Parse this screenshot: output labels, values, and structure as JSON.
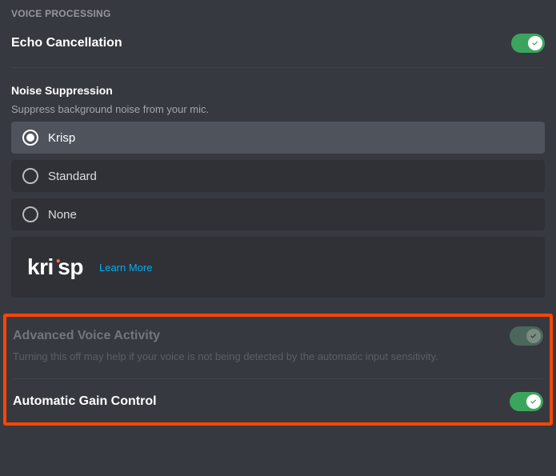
{
  "section_header": "VOICE PROCESSING",
  "echo": {
    "title": "Echo Cancellation",
    "enabled": true
  },
  "noise_suppression": {
    "title": "Noise Suppression",
    "description": "Suppress background noise from your mic.",
    "selected": "krisp",
    "options": {
      "krisp": "Krisp",
      "standard": "Standard",
      "none": "None"
    },
    "brand": "krisp",
    "learn_more": "Learn More"
  },
  "advanced_voice": {
    "title": "Advanced Voice Activity",
    "description": "Turning this off may help if your voice is not being detected by the automatic input sensitivity.",
    "enabled": true,
    "disabled_appearance": true
  },
  "auto_gain": {
    "title": "Automatic Gain Control",
    "enabled": true
  }
}
